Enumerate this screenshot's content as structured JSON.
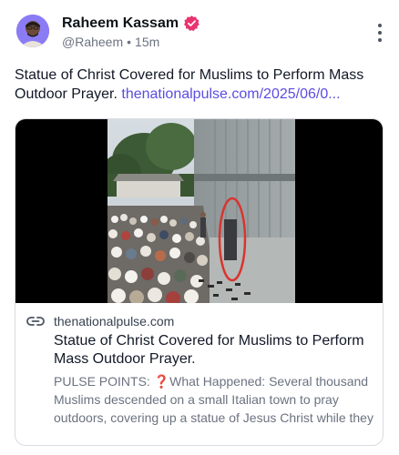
{
  "author": {
    "name": "Raheem Kassam",
    "handle": "@Raheem",
    "separator": "•",
    "time": "15m",
    "avatar_icon": "user-photo-avatar",
    "verified_icon": "verified-badge-icon"
  },
  "post": {
    "text": "Statue of Christ Covered for Muslims to Perform Mass Outdoor Prayer. ",
    "link_text": "thenationalpulse.com/2025/06/0..."
  },
  "embed": {
    "image_description_icon": "photo-crowd-prayer",
    "domain": "thenationalpulse.com",
    "title": "Statue of Christ Covered for Muslims to Perform Mass Outdoor Prayer.",
    "description": "PULSE POINTS: ❓What Happened: Several thousand Muslims descended on a small Italian town to pray outdoors, covering up a statue of Jesus Christ while they"
  },
  "colors": {
    "link": "#5b4de0",
    "verified_badge": "#e8336f",
    "secondary_text": "#6b7280",
    "card_border": "#d8dbe0"
  }
}
